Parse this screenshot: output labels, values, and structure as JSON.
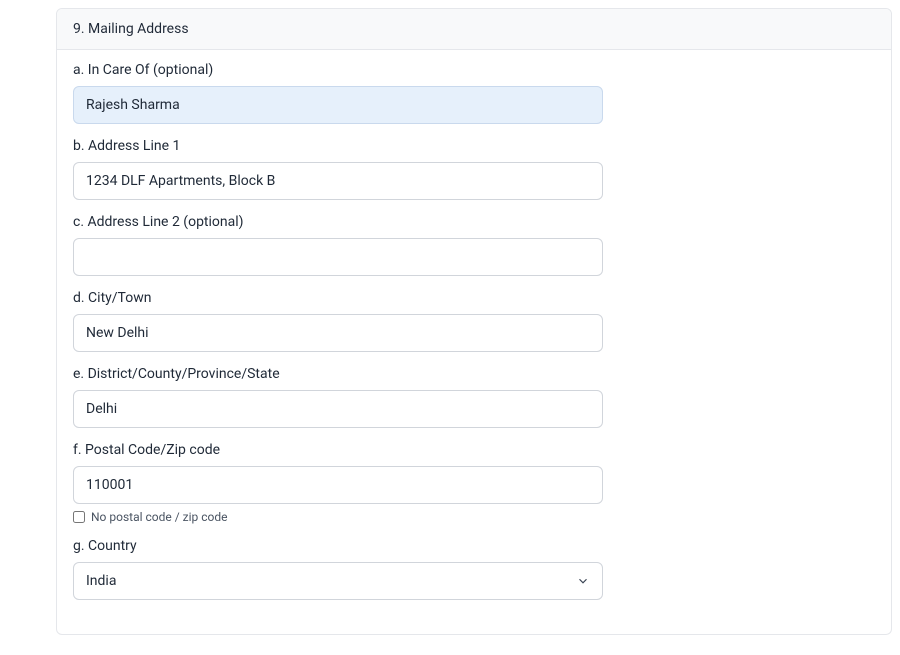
{
  "section": {
    "title": "9. Mailing Address",
    "fields": {
      "in_care_of": {
        "label": "a. In Care Of (optional)",
        "value": "Rajesh Sharma"
      },
      "address_line_1": {
        "label": "b. Address Line 1",
        "value": "1234 DLF Apartments, Block B"
      },
      "address_line_2": {
        "label": "c. Address Line 2 (optional)",
        "value": ""
      },
      "city": {
        "label": "d. City/Town",
        "value": "New Delhi"
      },
      "district": {
        "label": "e. District/County/Province/State",
        "value": "Delhi"
      },
      "postal_code": {
        "label": "f. Postal Code/Zip code",
        "value": "110001",
        "no_postal_label": "No postal code / zip code",
        "no_postal_checked": false
      },
      "country": {
        "label": "g. Country",
        "value": "India"
      }
    }
  }
}
